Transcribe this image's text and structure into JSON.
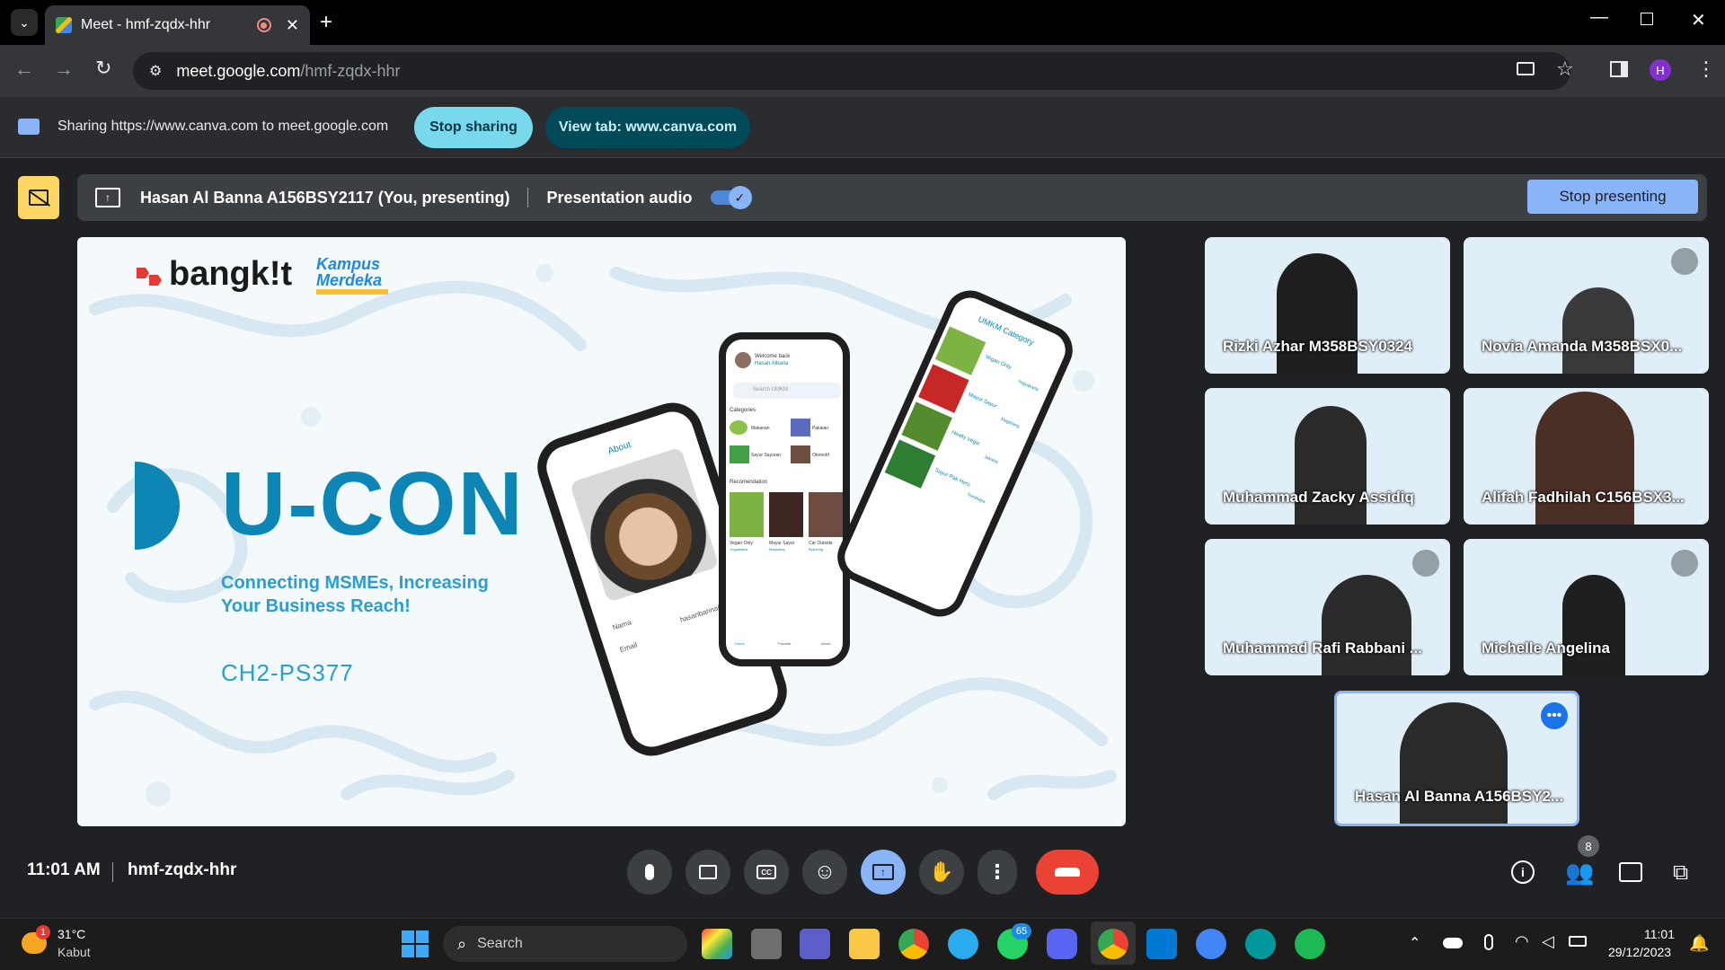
{
  "browser": {
    "tab_title": "Meet - hmf-zqdx-hhr",
    "url_host": "meet.google.com",
    "url_path": "/hmf-zqdx-hhr",
    "profile_initial": "H"
  },
  "sharebar": {
    "text": "Sharing https://www.canva.com to meet.google.com",
    "stop_sharing": "Stop sharing",
    "view_tab": "View tab: www.canva.com"
  },
  "presenting": {
    "presenter": "Hasan Al Banna A156BSY2117 (You, presenting)",
    "audio_label": "Presentation audio",
    "stop_button": "Stop presenting"
  },
  "slide": {
    "logo_bangkit": "bangk!t",
    "logo_kampus_1": "Kampus",
    "logo_kampus_2": "Merdeka",
    "title": "U-CON",
    "subtitle_1": "Connecting MSMEs, Increasing",
    "subtitle_2": "Your Business Reach!",
    "code": "CH2-PS377",
    "phone_left_header": "About",
    "phone_left_fields": [
      "Nama",
      "Email"
    ],
    "phone_left_value": "hasanbanna0",
    "phone_mid_welcome": "Welcome back",
    "phone_mid_user": "Hasan Albana",
    "phone_mid_search": "Search UMKM",
    "phone_mid_categories_label": "Categories",
    "phone_mid_categories": [
      "Makanan",
      "Pakaian",
      "Sayur Sayuran",
      "Otomotif"
    ],
    "phone_mid_recommendation_label": "Recomendation",
    "phone_mid_recommendations": [
      "Vegan Only",
      "Mayur Sayur",
      "Car Outside"
    ],
    "phone_mid_rec_cities": [
      "Yogyakarta",
      "Magelang",
      "Bandung"
    ],
    "phone_mid_nav": [
      "Home",
      "Favorite",
      "About"
    ],
    "phone_right_header": "UMKM Category",
    "phone_right_items": [
      "Vegan Only",
      "Mayur Sayur",
      "Healty Vegie",
      "Sayur Pak Heru"
    ],
    "phone_right_cities": [
      "Yogyakarta",
      "Magelang",
      "Jakarta",
      "Surabaya"
    ]
  },
  "participants": [
    {
      "name": "Rizki Azhar M358BSY0324",
      "muted": false
    },
    {
      "name": "Novia Amanda M358BSX0...",
      "muted": true
    },
    {
      "name": "Muhammad Zacky Assidiq",
      "muted": false
    },
    {
      "name": "Alifah Fadhilah C156BSX3...",
      "muted": false
    },
    {
      "name": "Muhammad Rafi Rabbani ...",
      "muted": true
    },
    {
      "name": "Michelle Angelina",
      "muted": true
    }
  ],
  "self_tile": {
    "name": "Hasan Al Banna A156BSY2..."
  },
  "footer": {
    "time": "11:01 AM",
    "meeting_code": "hmf-zqdx-hhr",
    "people_count": "8"
  },
  "taskbar": {
    "weather_temp": "31°C",
    "weather_desc": "Kabut",
    "weather_badge": "1",
    "search": "Search",
    "whatsapp_badge": "65",
    "clock_time": "11:01",
    "clock_date": "29/12/2023"
  },
  "colors": {
    "accent_blue": "#8ab4f8",
    "share_pill": "#78d9ec",
    "view_pill": "#004a5a",
    "end_call": "#ea4335",
    "ucon_blue": "#0e86b5",
    "presenting_yellow": "#fdd663"
  }
}
